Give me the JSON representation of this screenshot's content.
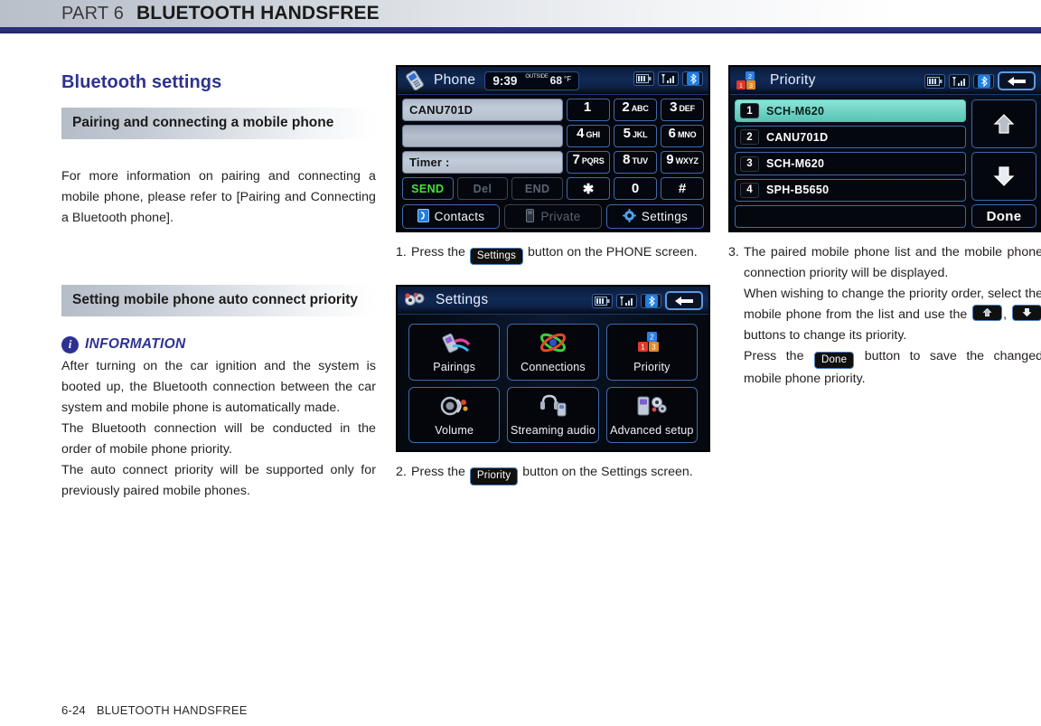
{
  "header": {
    "part_label": "PART 6",
    "part_title": "BLUETOOTH HANDSFREE",
    "rule_color": "#2b3080"
  },
  "left_column": {
    "chapter_title": "Bluetooth settings",
    "section_1": {
      "heading": "Pairing and connecting a mobile phone",
      "body": "For more information on pairing and connecting a mobile phone, please refer to [Pairing and Connecting a Bluetooth phone]."
    },
    "section_2": {
      "heading": "Setting mobile phone auto connect priority",
      "info_label": "INFORMATION",
      "info_icon": "info-circle-icon",
      "info_body_1": "After turning on the car ignition and the system is booted up, the Bluetooth connection between the car system and mobile phone is automatically made.",
      "info_body_2": "The Bluetooth connection will be conducted in the order of mobile phone priority.",
      "info_body_3": "The auto connect priority will be supported only for previously paired mobile phones."
    }
  },
  "phone_screen": {
    "icon": "phone-handset-icon",
    "title": "Phone",
    "clock": "9:39",
    "outside_label": "OUTSIDE",
    "temperature": "68",
    "temperature_unit": "°F",
    "status_icons": [
      "battery-icon",
      "signal-bars-icon",
      "bluetooth-icon"
    ],
    "field_name": "CANU701D",
    "field_number": "",
    "field_timer": "Timer :",
    "actions": [
      "SEND",
      "Del",
      "END"
    ],
    "keys": [
      {
        "digit": "1",
        "letters": ""
      },
      {
        "digit": "2",
        "letters": "ABC"
      },
      {
        "digit": "3",
        "letters": "DEF"
      },
      {
        "digit": "4",
        "letters": "GHI"
      },
      {
        "digit": "5",
        "letters": "JKL"
      },
      {
        "digit": "6",
        "letters": "MNO"
      },
      {
        "digit": "7",
        "letters": "PQRS"
      },
      {
        "digit": "8",
        "letters": "TUV"
      },
      {
        "digit": "9",
        "letters": "WXYZ"
      },
      {
        "digit": "✱",
        "letters": ""
      },
      {
        "digit": "0",
        "letters": ""
      },
      {
        "digit": "#",
        "letters": ""
      }
    ],
    "tabs": [
      "Contacts",
      "Private",
      "Settings"
    ]
  },
  "settings_screen": {
    "icon": "settings-gears-icon",
    "title": "Settings",
    "status_icons": [
      "battery-icon",
      "signal-bars-icon",
      "bluetooth-icon"
    ],
    "back_button": "back-arrow-icon",
    "tiles": [
      {
        "label": "Pairings",
        "icon": "pairings-icon"
      },
      {
        "label": "Connections",
        "icon": "connections-icon"
      },
      {
        "label": "Priority",
        "icon": "priority-blocks-icon"
      },
      {
        "label": "Volume",
        "icon": "volume-icon"
      },
      {
        "label": "Streaming audio",
        "icon": "streaming-audio-icon"
      },
      {
        "label": "Advanced setup",
        "icon": "advanced-setup-icon"
      }
    ]
  },
  "priority_screen": {
    "icon": "priority-blocks-icon",
    "title": "Priority",
    "status_icons": [
      "battery-icon",
      "signal-bars-icon",
      "bluetooth-icon"
    ],
    "back_button": "back-arrow-icon",
    "rows": [
      {
        "index": "1",
        "name": "SCH-M620",
        "selected": true
      },
      {
        "index": "2",
        "name": "CANU701D",
        "selected": false
      },
      {
        "index": "3",
        "name": "SCH-M620",
        "selected": false
      },
      {
        "index": "4",
        "name": "SPH-B5650",
        "selected": false
      }
    ],
    "up_button": "up-arrow-icon",
    "down_button": "down-arrow-icon",
    "done_button": "Done",
    "selected_row_color": "#6fd2c4"
  },
  "steps": {
    "step1": {
      "number": "1.",
      "text_before": "Press the",
      "keycap": "Settings",
      "text_after": "button on the PHONE screen."
    },
    "step2": {
      "number": "2.",
      "text_before": "Press the",
      "keycap": "Priority",
      "text_after": "button on the Settings screen."
    },
    "step3": {
      "number": "3.",
      "para_1": "The paired mobile phone list and the mobile phone connection priority will be displayed.",
      "para_2_before": "When wishing to change the priority order, select the mobile phone from the list and use the",
      "keycap_up": "up-arrow-icon",
      "keycap_down": "down-arrow-icon",
      "para_2_after": "buttons to change its priority.",
      "para_3_before": "Press the",
      "keycap_done": "Done",
      "para_3_after": "button to save the changed mobile phone priority."
    }
  },
  "footer": {
    "page_number": "6-24",
    "title": "BLUETOOTH HANDSFREE"
  }
}
